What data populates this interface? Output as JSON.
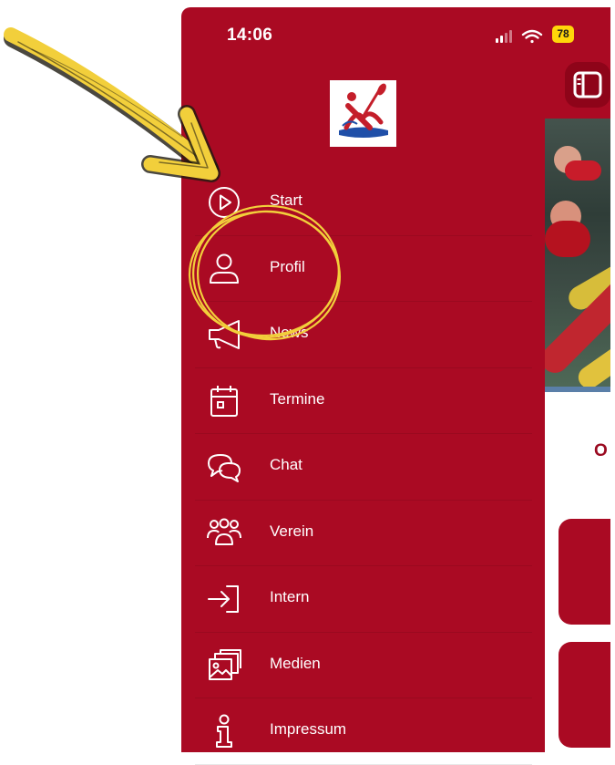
{
  "status_bar": {
    "time": "14:06",
    "battery": "78"
  },
  "menu": {
    "items": [
      {
        "label": "Start",
        "icon": "play-circle-icon"
      },
      {
        "label": "Profil",
        "icon": "user-icon"
      },
      {
        "label": "News",
        "icon": "megaphone-icon"
      },
      {
        "label": "Termine",
        "icon": "calendar-icon"
      },
      {
        "label": "Chat",
        "icon": "chat-bubbles-icon"
      },
      {
        "label": "Verein",
        "icon": "group-icon"
      },
      {
        "label": "Intern",
        "icon": "sign-in-icon"
      },
      {
        "label": "Medien",
        "icon": "images-icon"
      },
      {
        "label": "Impressum",
        "icon": "info-icon"
      }
    ]
  },
  "main": {
    "heading_partial": "O"
  },
  "colors": {
    "brand_red": "#aa0a23",
    "annotation_yellow": "#f2cf3b",
    "battery_yellow": "#ffd60a"
  }
}
